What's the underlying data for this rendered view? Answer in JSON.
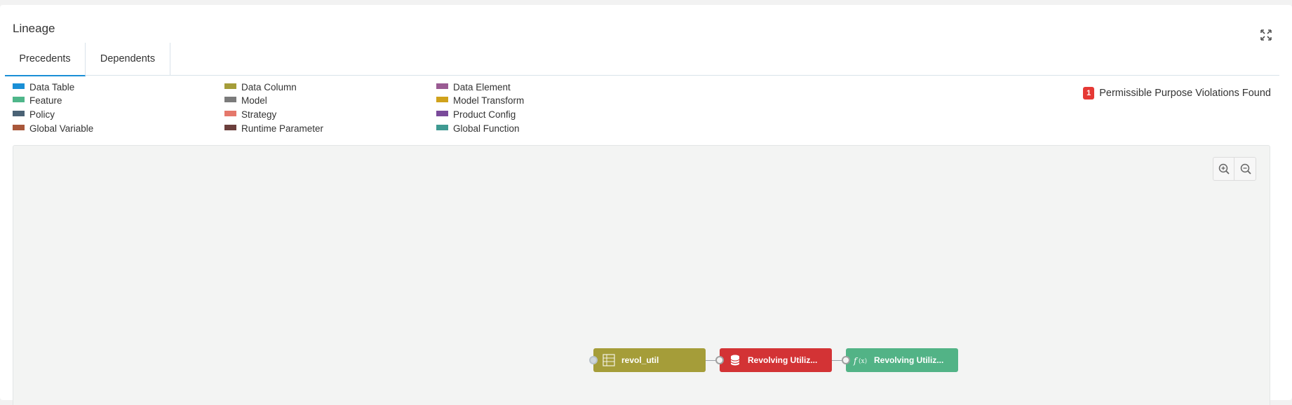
{
  "panel": {
    "title": "Lineage"
  },
  "tabs": [
    {
      "label": "Precedents",
      "active": true
    },
    {
      "label": "Dependents",
      "active": false
    }
  ],
  "legend": {
    "items": [
      {
        "label": "Data Table",
        "color": "#1a8fd6"
      },
      {
        "label": "Feature",
        "color": "#4fb68a"
      },
      {
        "label": "Policy",
        "color": "#4a6275"
      },
      {
        "label": "Global Variable",
        "color": "#a9573a"
      },
      {
        "label": "Data Column",
        "color": "#a59d39"
      },
      {
        "label": "Model",
        "color": "#7b7b7b"
      },
      {
        "label": "Strategy",
        "color": "#e5786b"
      },
      {
        "label": "Runtime Parameter",
        "color": "#6b3f3c"
      },
      {
        "label": "Data Element",
        "color": "#9a5b93"
      },
      {
        "label": "Model Transform",
        "color": "#d0a21c"
      },
      {
        "label": "Product Config",
        "color": "#7a4a9a"
      },
      {
        "label": "Global Function",
        "color": "#3f9a92"
      }
    ]
  },
  "violations": {
    "count": "1",
    "text": "Permissible Purpose Violations Found",
    "badge_color": "#e53935"
  },
  "graph": {
    "zoom_in_icon": "zoom-in-icon",
    "zoom_out_icon": "zoom-out-icon",
    "nodes": [
      {
        "label": "revol_util",
        "type": "Data Column",
        "color": "#a59d39",
        "icon": "data-column-icon"
      },
      {
        "label": "Revolving Utiliz...",
        "type": "Data Element",
        "color": "#d33335",
        "icon": "database-icon"
      },
      {
        "label": "Revolving Utiliz...",
        "type": "Global Function",
        "color": "#52b386",
        "icon": "function-icon"
      }
    ]
  }
}
